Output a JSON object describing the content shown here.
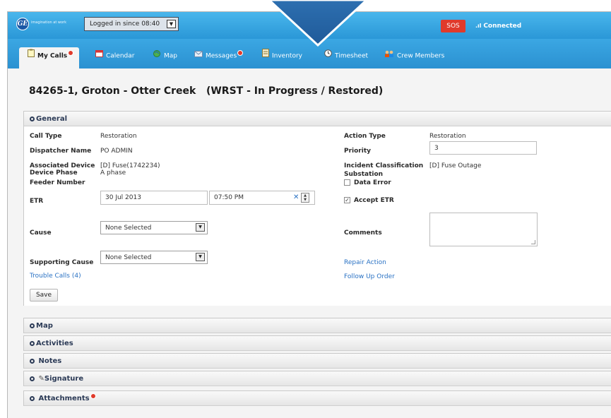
{
  "header": {
    "logo_text": "GE",
    "tagline": "imagination at work",
    "login_status": "Logged in since 08:40",
    "sos_label": "SOS",
    "connection_status": "Connected"
  },
  "tabs": [
    {
      "label": "My Calls",
      "badge": true,
      "active": true,
      "icon": "clipboard-icon"
    },
    {
      "label": "Calendar",
      "badge": false,
      "active": false,
      "icon": "calendar-icon"
    },
    {
      "label": "Map",
      "badge": false,
      "active": false,
      "icon": "map-icon"
    },
    {
      "label": "Messages",
      "badge": true,
      "active": false,
      "icon": "envelope-icon"
    },
    {
      "label": "Inventory",
      "badge": false,
      "active": false,
      "icon": "inventory-icon"
    },
    {
      "label": "Timesheet",
      "badge": false,
      "active": false,
      "icon": "clock-icon"
    },
    {
      "label": "Crew Members",
      "badge": false,
      "active": false,
      "icon": "crew-icon"
    }
  ],
  "page": {
    "title": "84265-1, Groton - Otter Creek   (WRST - In Progress / Restored)"
  },
  "general": {
    "header": "General",
    "call_type_label": "Call Type",
    "call_type_value": "Restoration",
    "dispatcher_label": "Dispatcher Name",
    "dispatcher_value": "PO ADMIN",
    "associated_device_label": "Associated Device",
    "associated_device_value": "[D] Fuse(1742234)",
    "device_phase_label": "Device Phase",
    "device_phase_value": "A phase",
    "feeder_label": "Feeder Number",
    "etr_label": "ETR",
    "etr_date": "30 Jul 2013",
    "etr_time": "07:50 PM",
    "cause_label": "Cause",
    "cause_value": "None Selected",
    "supporting_cause_label": "Supporting Cause",
    "supporting_cause_value": "None Selected",
    "trouble_calls_link": "Trouble Calls (4)",
    "save_label": "Save",
    "action_type_label": "Action Type",
    "action_type_value": "Restoration",
    "priority_label": "Priority",
    "priority_value": "3",
    "incident_class_label": "Incident Classification",
    "incident_class_value": "[D] Fuse Outage",
    "substation_label": "Substation",
    "data_error_label": "Data Error",
    "data_error_checked": false,
    "accept_etr_label": "Accept ETR",
    "accept_etr_checked": true,
    "comments_label": "Comments",
    "comments_value": "",
    "repair_action_link": "Repair Action",
    "follow_up_link": "Follow Up Order"
  },
  "sections": [
    {
      "label": "Map",
      "badge": false
    },
    {
      "label": "Activities",
      "badge": false
    },
    {
      "label": "Notes",
      "badge": false
    },
    {
      "label": "Signature",
      "badge": false
    },
    {
      "label": "Attachments",
      "badge": true
    }
  ],
  "colors": {
    "header_blue": "#2a97d7",
    "sos_red": "#e03a2b",
    "link_blue": "#2a72c4",
    "title_navy": "#2b3a56"
  }
}
